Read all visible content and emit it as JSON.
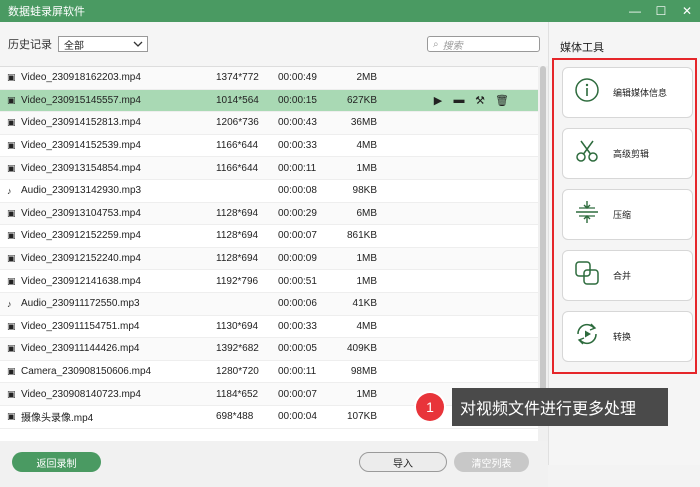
{
  "app": {
    "title": "数据蛙录屏软件"
  },
  "window_controls": [
    "—",
    "☐",
    "✕"
  ],
  "toolbar": {
    "history_label": "历史记录",
    "filter_value": "全部",
    "search_placeholder": "搜索"
  },
  "files": [
    {
      "type": "video",
      "name": "Video_230918162203.mp4",
      "resolution": "1374*772",
      "duration": "00:00:49",
      "size": "2MB"
    },
    {
      "type": "video",
      "name": "Video_230915145557.mp4",
      "resolution": "1014*564",
      "duration": "00:00:15",
      "size": "627KB",
      "selected": true
    },
    {
      "type": "video",
      "name": "Video_230914152813.mp4",
      "resolution": "1206*736",
      "duration": "00:00:43",
      "size": "36MB"
    },
    {
      "type": "video",
      "name": "Video_230914152539.mp4",
      "resolution": "1166*644",
      "duration": "00:00:33",
      "size": "4MB"
    },
    {
      "type": "video",
      "name": "Video_230913154854.mp4",
      "resolution": "1166*644",
      "duration": "00:00:11",
      "size": "1MB"
    },
    {
      "type": "audio",
      "name": "Audio_230913142930.mp3",
      "resolution": "",
      "duration": "00:00:08",
      "size": "98KB"
    },
    {
      "type": "video",
      "name": "Video_230913104753.mp4",
      "resolution": "1128*694",
      "duration": "00:00:29",
      "size": "6MB"
    },
    {
      "type": "video",
      "name": "Video_230912152259.mp4",
      "resolution": "1128*694",
      "duration": "00:00:07",
      "size": "861KB"
    },
    {
      "type": "video",
      "name": "Video_230912152240.mp4",
      "resolution": "1128*694",
      "duration": "00:00:09",
      "size": "1MB"
    },
    {
      "type": "video",
      "name": "Video_230912141638.mp4",
      "resolution": "1192*796",
      "duration": "00:00:51",
      "size": "1MB"
    },
    {
      "type": "audio",
      "name": "Audio_230911172550.mp3",
      "resolution": "",
      "duration": "00:00:06",
      "size": "41KB"
    },
    {
      "type": "video",
      "name": "Video_230911154751.mp4",
      "resolution": "1130*694",
      "duration": "00:00:33",
      "size": "4MB"
    },
    {
      "type": "video",
      "name": "Video_230911144426.mp4",
      "resolution": "1392*682",
      "duration": "00:00:05",
      "size": "409KB"
    },
    {
      "type": "video",
      "name": "Camera_230908150606.mp4",
      "resolution": "1280*720",
      "duration": "00:00:11",
      "size": "98MB"
    },
    {
      "type": "video",
      "name": "Video_230908140723.mp4",
      "resolution": "1184*652",
      "duration": "00:00:07",
      "size": "1MB"
    },
    {
      "type": "video",
      "name": "摄像头录像.mp4",
      "resolution": "698*488",
      "duration": "00:00:04",
      "size": "107KB"
    }
  ],
  "row_actions": [
    "play-icon",
    "folder-icon",
    "tools-icon",
    "trash-icon"
  ],
  "buttons": {
    "back": "返回录制",
    "import": "导入",
    "clear": "清空列表"
  },
  "side": {
    "heading": "媒体工具",
    "tools": [
      {
        "name": "edit-info",
        "icon": "info-icon",
        "label": "编辑媒体信息"
      },
      {
        "name": "advanced-cut",
        "icon": "scissors-icon",
        "label": "高级剪辑"
      },
      {
        "name": "compress",
        "icon": "compress-icon",
        "label": "压缩"
      },
      {
        "name": "merge",
        "icon": "merge-icon",
        "label": "合并"
      },
      {
        "name": "convert",
        "icon": "convert-icon",
        "label": "转换"
      }
    ]
  },
  "callout": {
    "number": "1",
    "text": "对视频文件进行更多处理"
  },
  "colors": {
    "brand_green": "#4a9a62",
    "selected_row": "#a9d9b4",
    "highlight_red": "#e5262a"
  }
}
